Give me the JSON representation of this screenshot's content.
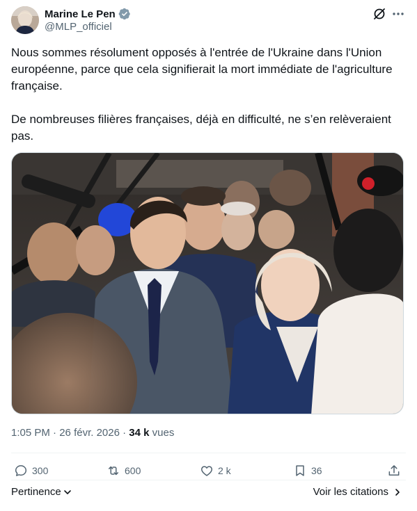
{
  "author": {
    "name": "Marine Le Pen",
    "handle": "@MLP_officiel"
  },
  "post": {
    "text": "Nous sommes résolument opposés à l'entrée de l'Ukraine dans l'Union\neuropéenne, parce que cela signifierait la mort immédiate de l'agriculture\nfrançaise.\n\nDe nombreuses filières françaises, déjà en difficulté, ne s’en relèveraient\npas.",
    "time": "1:05 PM",
    "separator": " · ",
    "date": "26 févr. 2026",
    "views_count": "34 k",
    "views_label": " vues"
  },
  "actions": {
    "replies": "300",
    "reposts": "600",
    "likes": "2 k",
    "bookmarks": "36"
  },
  "footer": {
    "sort_label": "Pertinence",
    "quotes_label": "Voir les citations"
  },
  "colors": {
    "text": "#0f1419",
    "secondary": "#536471",
    "verified": "#829aab",
    "divider": "#eff3f4"
  },
  "icons": {
    "verified": "verified-badge-icon",
    "grok": "grok-icon",
    "more": "more-icon",
    "reply": "reply-icon",
    "repost": "repost-icon",
    "like": "heart-icon",
    "bookmark": "bookmark-icon",
    "share": "share-icon"
  }
}
